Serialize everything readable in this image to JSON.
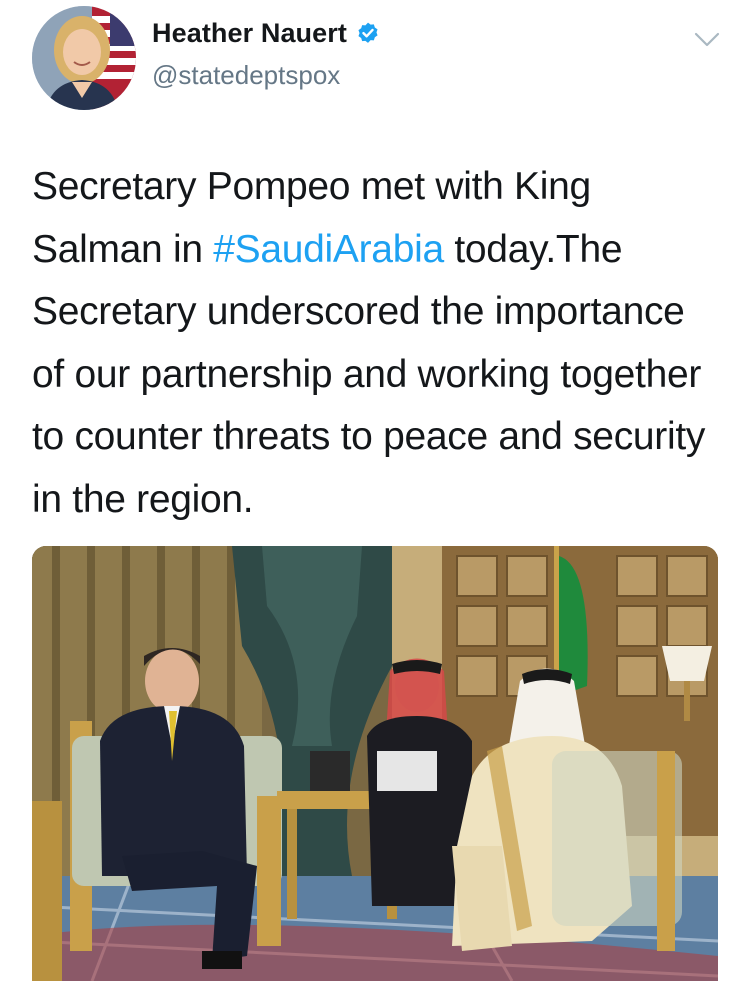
{
  "user": {
    "display_name": "Heather Nauert",
    "handle": "@statedeptspox",
    "verified": true,
    "avatar_icon": "profile-photo"
  },
  "tweet": {
    "text_before": "Secretary Pompeo met with King Salman in ",
    "hashtag": "#SaudiArabia",
    "text_after": " today.The Secretary underscored the importance of our partnership and working together to counter threats to peace and security in the region."
  },
  "media": {
    "type": "photo"
  },
  "icons": {
    "verified": "verified-badge-icon",
    "menu": "chevron-down-icon"
  },
  "colors": {
    "link": "#1da1f2",
    "text": "#14171a",
    "secondary": "#657786",
    "verified": "#1da1f2"
  }
}
